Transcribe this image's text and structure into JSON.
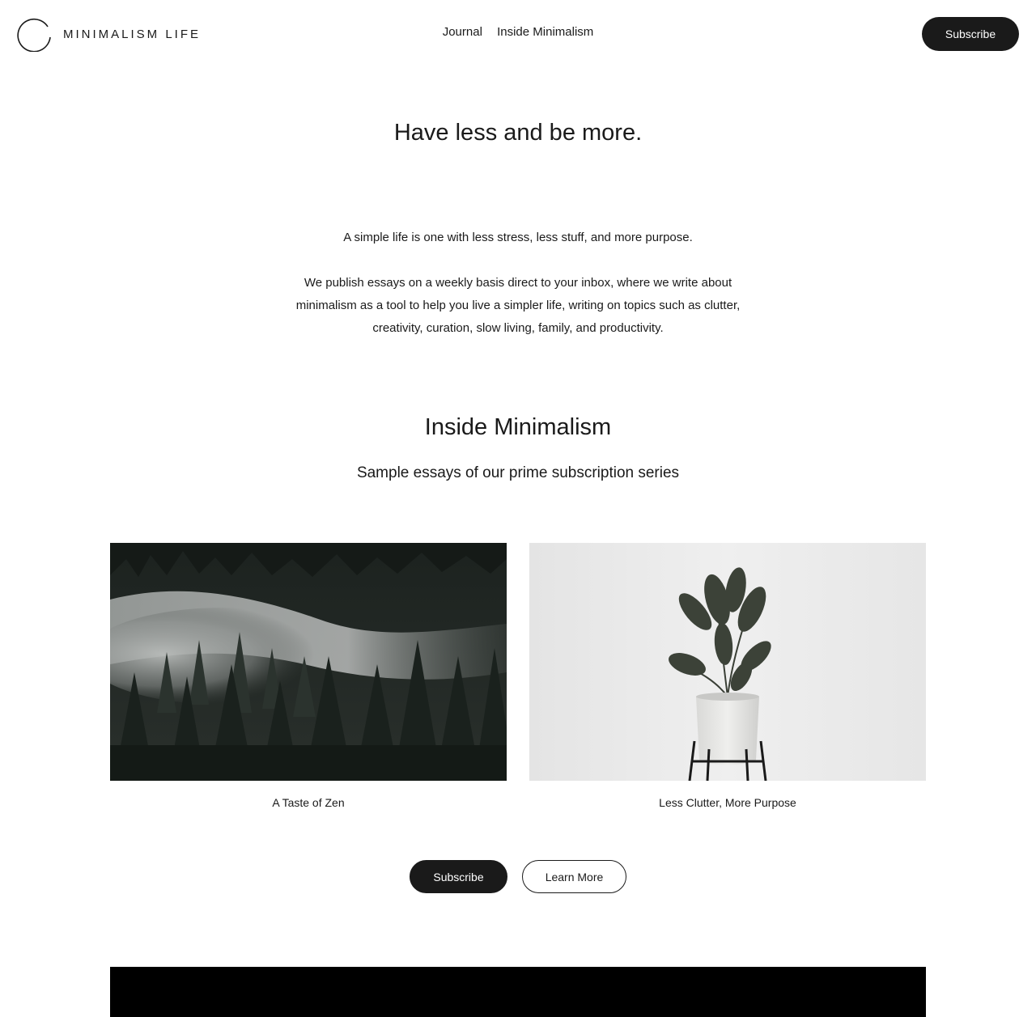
{
  "header": {
    "logo_text": "MINIMALISM LIFE",
    "nav": [
      "Journal",
      "Inside Minimalism"
    ],
    "subscribe_label": "Subscribe"
  },
  "hero": {
    "title": "Have less and be more.",
    "intro_1": "A simple life is one with less stress, less stuff, and more purpose.",
    "intro_2": "We publish essays on a weekly basis direct to your inbox, where we write about minimalism as a tool to help you live a simpler life, writing on topics such as clutter, creativity, curation, slow living, family, and productivity."
  },
  "section": {
    "title": "Inside Minimalism",
    "subtitle": "Sample essays of our prime subscription series"
  },
  "cards": [
    {
      "caption": "A Taste of Zen",
      "image": "misty-forest-photo"
    },
    {
      "caption": "Less Clutter, More Purpose",
      "image": "potted-plant-photo"
    }
  ],
  "cta": {
    "subscribe_label": "Subscribe",
    "learn_more_label": "Learn More"
  },
  "colors": {
    "text": "#1a1a1a",
    "button_dark": "#1a1a1a",
    "background": "#ffffff"
  }
}
